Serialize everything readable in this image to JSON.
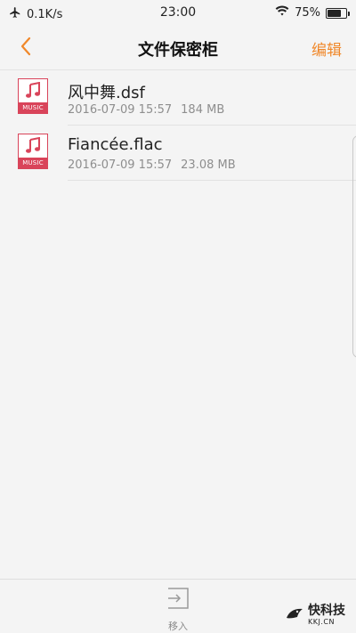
{
  "status_bar": {
    "network_speed": "0.1K/s",
    "time": "23:00",
    "battery_percent": "75%",
    "battery_level": 0.75,
    "icons": [
      "airplane-icon",
      "wifi-icon",
      "battery-icon"
    ]
  },
  "nav": {
    "title": "文件保密柜",
    "edit_label": "编辑",
    "back_icon": "chevron-left-icon"
  },
  "files": [
    {
      "name": "风中舞.dsf",
      "date": "2016-07-09 15:57",
      "size": "184 MB",
      "badge": "MUSIC",
      "icon": "music-file-icon"
    },
    {
      "name": "Fiancée.flac",
      "date": "2016-07-09 15:57",
      "size": "23.08 MB",
      "badge": "MUSIC",
      "icon": "music-file-icon"
    }
  ],
  "bottom": {
    "move_in_label": "移入",
    "move_in_icon": "move-in-icon"
  },
  "watermark": {
    "main": "快科技",
    "sub": "KKJ.CN"
  },
  "colors": {
    "accent": "#f0882a",
    "music_badge": "#d9445a",
    "background": "#f4f4f4"
  }
}
